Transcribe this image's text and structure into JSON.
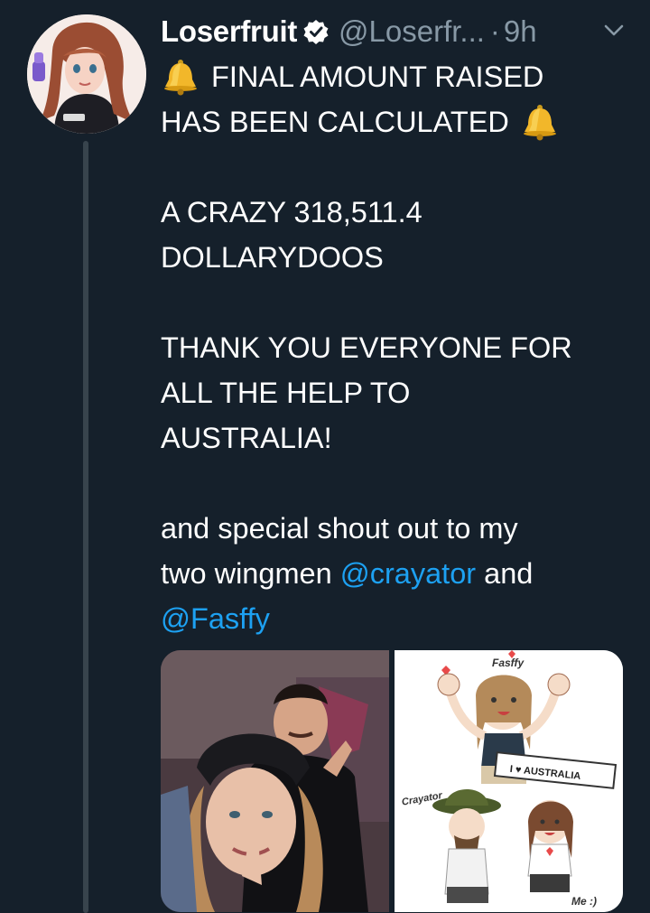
{
  "tweet": {
    "name": "Loserfruit",
    "handle": "@Loserfr...",
    "separator": "·",
    "time": "9h",
    "lines": {
      "l1": "FINAL AMOUNT RAISED",
      "l2": "HAS BEEN CALCULATED",
      "l3": "A CRAZY 318,511.4",
      "l4": "DOLLARYDOOS",
      "l5": "THANK YOU EVERYONE FOR",
      "l6": "ALL THE HELP TO",
      "l7": "AUSTRALIA!",
      "l8": "and special shout out to my",
      "l9a": "two wingmen ",
      "l9b": "@crayator",
      "l9c": " and",
      "l10": "@Fasffy"
    },
    "image_right": {
      "label_top": "Fasffy",
      "label_left": "Crayator",
      "sign": "I ♥ AUSTRALIA",
      "label_me": "Me :)"
    }
  },
  "colors": {
    "background": "#15202b",
    "secondary_text": "#8899a6",
    "link": "#1da1f2",
    "verified": "#ffffff"
  },
  "icons": [
    "verified-badge-icon",
    "chevron-down-icon",
    "bell-icon"
  ]
}
